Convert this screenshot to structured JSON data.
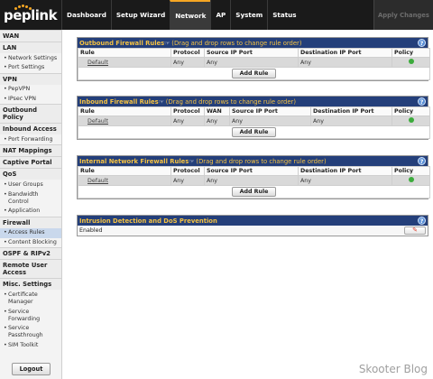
{
  "brand": "peplink",
  "nav": {
    "items": [
      "Dashboard",
      "Setup Wizard",
      "Network",
      "AP",
      "System",
      "Status"
    ],
    "active_index": 2,
    "apply_label": "Apply Changes"
  },
  "sidebar": {
    "sections": [
      {
        "title": "WAN",
        "items": []
      },
      {
        "title": "LAN",
        "items": [
          "Network Settings",
          "Port Settings"
        ]
      },
      {
        "title": "VPN",
        "items": [
          "PepVPN",
          "IPsec VPN"
        ]
      },
      {
        "title": "Outbound Policy",
        "items": []
      },
      {
        "title": "Inbound Access",
        "items": [
          "Port Forwarding"
        ]
      },
      {
        "title": "NAT Mappings",
        "items": []
      },
      {
        "title": "Captive Portal",
        "items": []
      },
      {
        "title": "QoS",
        "items": [
          "User Groups",
          "Bandwidth Control",
          "Application"
        ]
      },
      {
        "title": "Firewall",
        "items": [
          "Access Rules",
          "Content Blocking"
        ]
      },
      {
        "title": "OSPF & RIPv2",
        "items": []
      },
      {
        "title": "Remote User Access",
        "items": []
      },
      {
        "title": "Misc. Settings",
        "items": [
          "Certificate Manager",
          "Service Forwarding",
          "Service Passthrough",
          "SIM Toolkit"
        ]
      }
    ],
    "active_item": "Access Rules",
    "logout_label": "Logout"
  },
  "outbound": {
    "title": "Outbound Firewall Rules",
    "hint": "(Drag and drop rows to change rule order)",
    "columns": [
      "Rule",
      "Protocol",
      "Source IP Port",
      "Destination IP Port",
      "Policy"
    ],
    "row": {
      "rule": "Default",
      "protocol": "Any",
      "source": "Any",
      "destination": "Any"
    },
    "add_label": "Add Rule"
  },
  "inbound": {
    "title": "Inbound Firewall Rules",
    "hint": "(Drag and drop rows to change rule order)",
    "columns": [
      "Rule",
      "Protocol",
      "WAN",
      "Source IP Port",
      "Destination IP Port",
      "Policy"
    ],
    "row": {
      "rule": "Default",
      "protocol": "Any",
      "wan": "Any",
      "source": "Any",
      "destination": "Any"
    },
    "add_label": "Add Rule"
  },
  "internal": {
    "title": "Internal Network Firewall Rules",
    "hint": "(Drag and drop rows to change rule order)",
    "columns": [
      "Rule",
      "Protocol",
      "Source IP Port",
      "Destination IP Port",
      "Policy"
    ],
    "row": {
      "rule": "Default",
      "protocol": "Any",
      "source": "Any",
      "destination": "Any"
    },
    "add_label": "Add Rule"
  },
  "ids": {
    "title": "Intrusion Detection and DoS Prevention",
    "status": "Enabled"
  },
  "help_glyph": "?",
  "watermark": "Skooter Blog",
  "colors": {
    "header_bg": "#243f7a",
    "header_text": "#f5c242",
    "accent": "#f5a623",
    "policy_allow": "#3cab3c"
  }
}
